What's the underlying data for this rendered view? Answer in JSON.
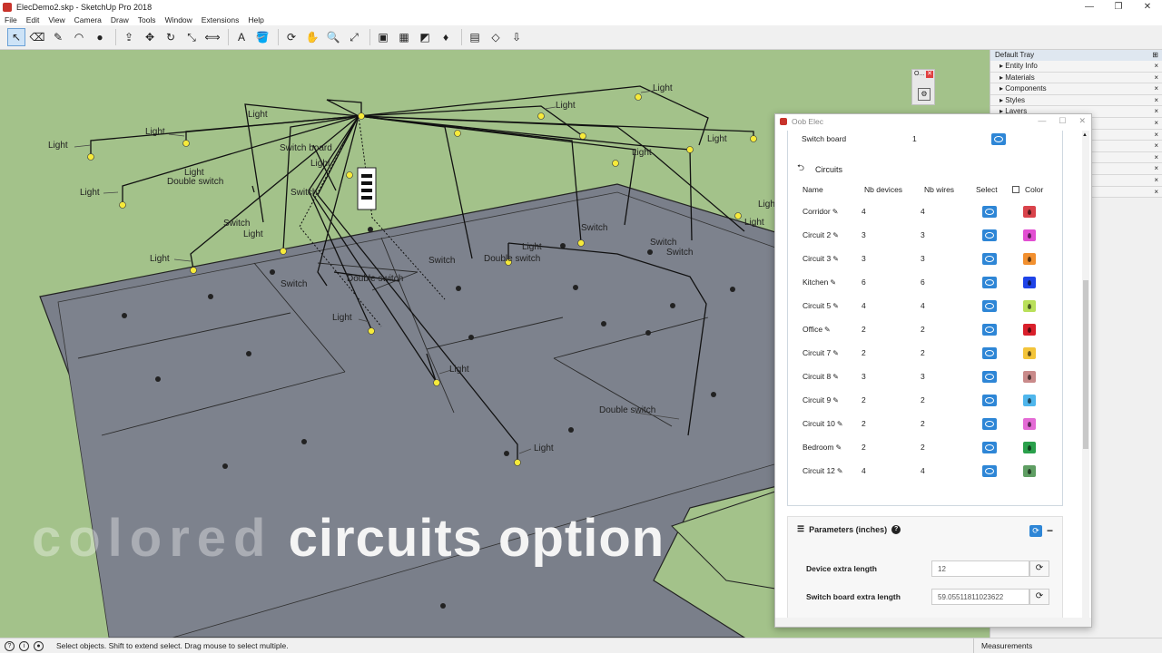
{
  "window": {
    "title": "ElecDemo2.skp - SketchUp Pro 2018",
    "minimize": "—",
    "restore": "❐",
    "close": "✕"
  },
  "menu": [
    "File",
    "Edit",
    "View",
    "Camera",
    "Draw",
    "Tools",
    "Window",
    "Extensions",
    "Help"
  ],
  "toolbar": {
    "tools": [
      "select-icon",
      "eraser-icon",
      "pencil-icon",
      "arc-icon",
      "shape-icon",
      "push-pull-icon",
      "move-icon",
      "rotate-icon",
      "scale-icon",
      "tape-measure-icon",
      "text-icon",
      "paint-bucket-icon",
      "orbit-icon",
      "pan-icon",
      "zoom-icon",
      "zoom-extents-icon",
      "warehouse-icon",
      "extension-warehouse-icon",
      "layout-icon",
      "ruby-icon",
      "section-plane-icon",
      "display-section-icon",
      "fill-section-icon"
    ],
    "glyphs": [
      "↖",
      "⌫",
      "✎",
      "◠",
      "●",
      "⇪",
      "✥",
      "↻",
      "⤡",
      "⟺",
      "A",
      "🪣",
      "⟳",
      "✋",
      "🔍",
      "⤢",
      "▣",
      "▦",
      "◩",
      "♦",
      "▤",
      "◇",
      "⇩"
    ]
  },
  "viewport": {
    "overlay_fade": "colored",
    "overlay_main": "circuits option",
    "labels": [
      "Light",
      "Light",
      "Light",
      "Light",
      "Light",
      "Light",
      "Switch",
      "Switch board",
      "Double switch",
      "Light",
      "Switch",
      "Light",
      "Switch",
      "Switch",
      "Double switch",
      "Double switch",
      "Light",
      "Light",
      "Light",
      "Switch",
      "Switch",
      "Light",
      "Light",
      "Light",
      "Double switch",
      "Light",
      "Light",
      "Light",
      "Switch",
      "Light"
    ]
  },
  "mini_window": {
    "title": "O...",
    "close": "✕",
    "icon": "⚙"
  },
  "tray": {
    "title": "Default Tray",
    "pin": "⊞",
    "items": [
      "Entity Info",
      "Materials",
      "Components",
      "Styles",
      "Layers",
      "",
      "",
      "",
      "",
      "",
      "",
      ""
    ]
  },
  "dialog": {
    "title": "Oob Elec",
    "minimize": "—",
    "maximize": "☐",
    "close": "✕",
    "switch_board": {
      "label": "Switch board",
      "value": "1"
    },
    "circuits_title": "Circuits",
    "columns": {
      "name": "Name",
      "devices": "Nb devices",
      "wires": "Nb wires",
      "select": "Select",
      "color": "Color"
    },
    "rows": [
      {
        "name": "Corridor",
        "devices": "4",
        "wires": "4",
        "color": "#d9434b"
      },
      {
        "name": "Circuit 2",
        "devices": "3",
        "wires": "3",
        "color": "#e24fd2"
      },
      {
        "name": "Circuit 3",
        "devices": "3",
        "wires": "3",
        "color": "#f2902f"
      },
      {
        "name": "Kitchen",
        "devices": "6",
        "wires": "6",
        "color": "#1f44e8"
      },
      {
        "name": "Circuit 5",
        "devices": "4",
        "wires": "4",
        "color": "#b9e05a"
      },
      {
        "name": "Office",
        "devices": "2",
        "wires": "2",
        "color": "#d9202b"
      },
      {
        "name": "Circuit 7",
        "devices": "2",
        "wires": "2",
        "color": "#f3c43a"
      },
      {
        "name": "Circuit 8",
        "devices": "3",
        "wires": "3",
        "color": "#c98a8a"
      },
      {
        "name": "Circuit 9",
        "devices": "2",
        "wires": "2",
        "color": "#4fb6ec"
      },
      {
        "name": "Circuit 10",
        "devices": "2",
        "wires": "2",
        "color": "#e46bd5"
      },
      {
        "name": "Bedroom",
        "devices": "2",
        "wires": "2",
        "color": "#2aa04b"
      },
      {
        "name": "Circuit 12",
        "devices": "4",
        "wires": "4",
        "color": "#5f9e63"
      }
    ],
    "params": {
      "title": "Parameters (inches)",
      "help": "?",
      "refresh": "⟳",
      "collapse": "−",
      "fields": [
        {
          "label": "Device extra length",
          "value": "12"
        },
        {
          "label": "Switch board extra length",
          "value": "59.05511811023622"
        }
      ],
      "spin": "⟳"
    }
  },
  "status": {
    "message": "Select objects. Shift to extend select. Drag mouse to select multiple.",
    "measurements": "Measurements",
    "icons": [
      "?",
      "i",
      "●"
    ]
  }
}
